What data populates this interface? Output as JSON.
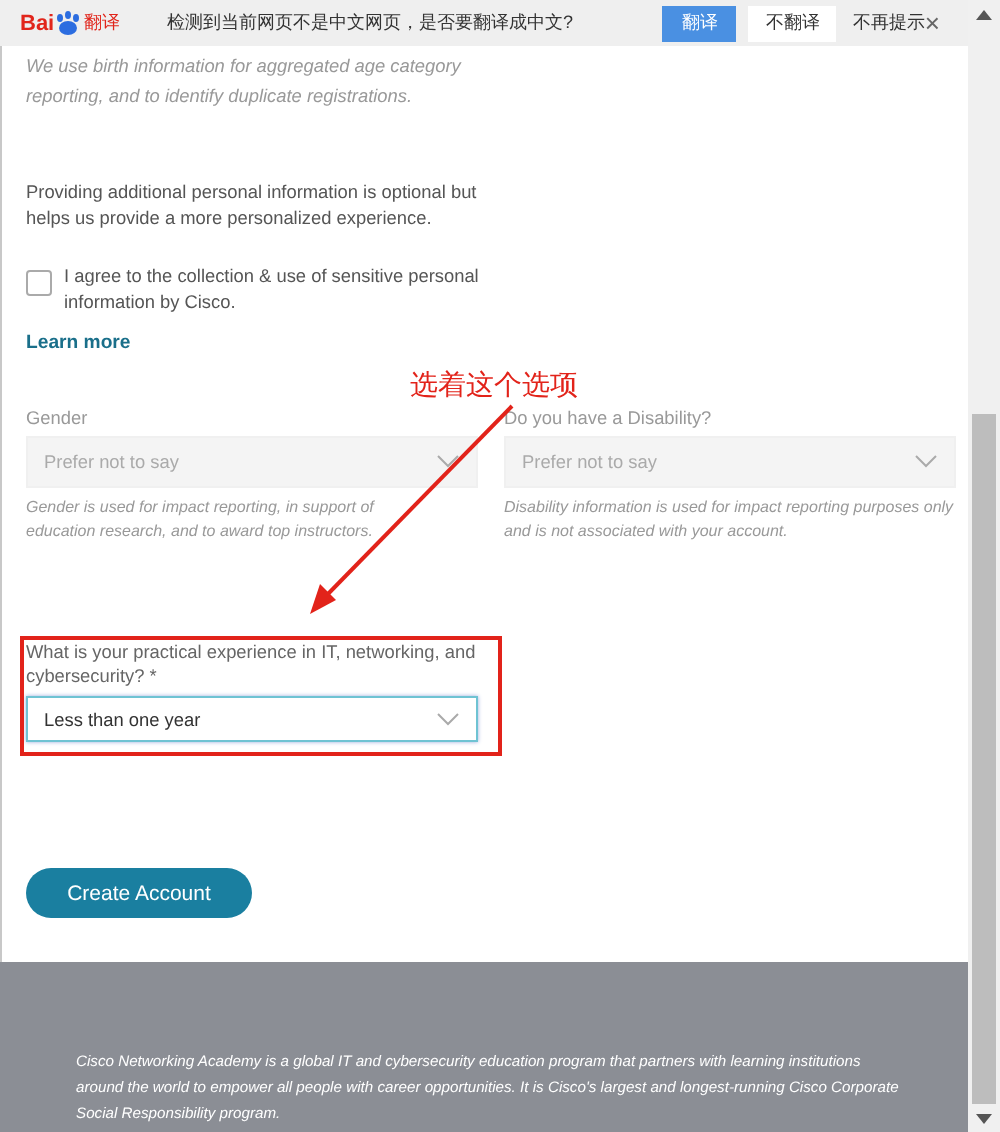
{
  "translate_bar": {
    "logo": "Bai",
    "logo_suffix": "翻译",
    "message": "检测到当前网页不是中文网页，是否要翻译成中文?",
    "buttons": [
      {
        "label": "翻译",
        "kind": "primary"
      },
      {
        "label": "不翻译",
        "kind": "secondary"
      }
    ],
    "link": "不再提示",
    "close": "×"
  },
  "form": {
    "birth_note": "We use birth information for aggregated age category reporting, and to identify duplicate registrations.",
    "optional_note": "Providing additional personal information is optional but helps us provide a more personalized experience.",
    "consent": {
      "label": "I agree to the collection & use of sensitive personal information by Cisco.",
      "checked": false
    },
    "learn_more": "Learn more",
    "fields": [
      {
        "label": "Gender",
        "value": "Prefer not to say",
        "disabled": true,
        "helper": "Gender is used for impact reporting, in support of education research, and to award top instructors."
      },
      {
        "label": "Do you have a Disability?",
        "value": "Prefer not to say",
        "disabled": true,
        "helper": "Disability information is used for impact reporting purposes only and is not associated with your account."
      }
    ],
    "experience": {
      "label": "What is your practical experience in IT, networking, and cybersecurity? *",
      "value": "Less than one year",
      "focused": true
    },
    "create_button": "Create Account"
  },
  "annotation": {
    "text": "选着这个选项"
  },
  "footer": {
    "text": "Cisco Networking Academy is a global IT and cybersecurity education program that partners with learning institutions around the world to empower all people with career opportunities. It is Cisco's largest and longest-running Cisco Corporate Social Responsibility program."
  }
}
